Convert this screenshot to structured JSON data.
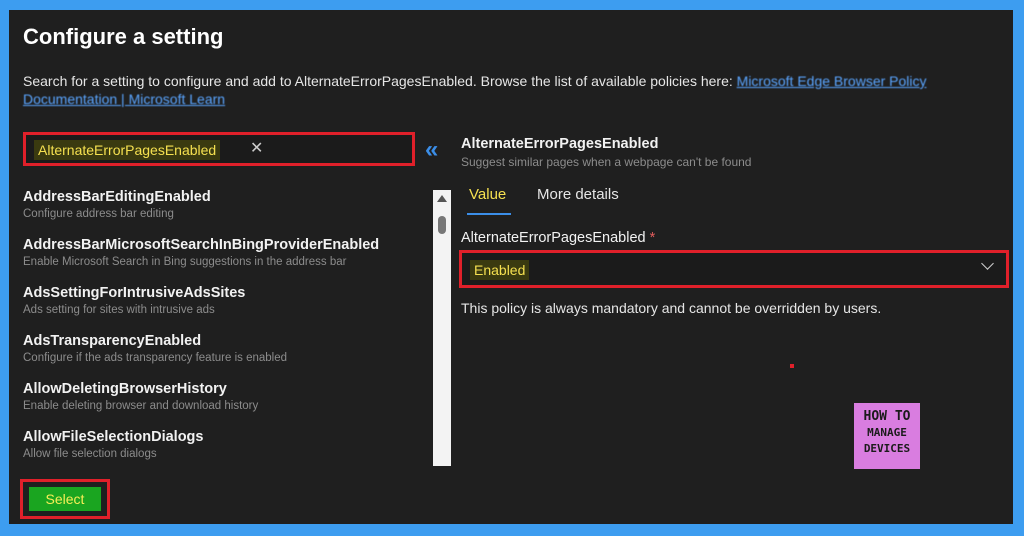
{
  "dialog": {
    "title": "Configure a setting",
    "description": "Search for a setting to configure and add to AlternateErrorPagesEnabled. Browse the list of available policies here:",
    "link_text": "Microsoft Edge Browser Policy Documentation | Microsoft Learn"
  },
  "search": {
    "value": "AlternateErrorPagesEnabled",
    "clear_glyph": "✕",
    "collapse_glyph": "«"
  },
  "settings_list": [
    {
      "name": "AddressBarEditingEnabled",
      "description": "Configure address bar editing"
    },
    {
      "name": "AddressBarMicrosoftSearchInBingProviderEnabled",
      "description": "Enable Microsoft Search in Bing suggestions in the address bar"
    },
    {
      "name": "AdsSettingForIntrusiveAdsSites",
      "description": "Ads setting for sites with intrusive ads"
    },
    {
      "name": "AdsTransparencyEnabled",
      "description": "Configure if the ads transparency feature is enabled"
    },
    {
      "name": "AllowDeletingBrowserHistory",
      "description": "Enable deleting browser and download history"
    },
    {
      "name": "AllowFileSelectionDialogs",
      "description": "Allow file selection dialogs"
    }
  ],
  "select_button": "Select",
  "detail": {
    "title": "AlternateErrorPagesEnabled",
    "subtitle": "Suggest similar pages when a webpage can't be found",
    "tabs": [
      "Value",
      "More details"
    ],
    "field_label": "AlternateErrorPagesEnabled",
    "required_mark": "*",
    "dropdown_value": "Enabled",
    "note": "This policy is always mandatory and cannot be overridden by users."
  },
  "logo": {
    "line1": "HOW TO",
    "line2": "MANAGE",
    "line3": "DEVICES"
  },
  "colors": {
    "accent": "#3b8ee8",
    "highlight": "#f5e050",
    "annotation_red": "#e0202a",
    "select_green": "#1aa520",
    "frame_blue": "#3d9df0"
  }
}
